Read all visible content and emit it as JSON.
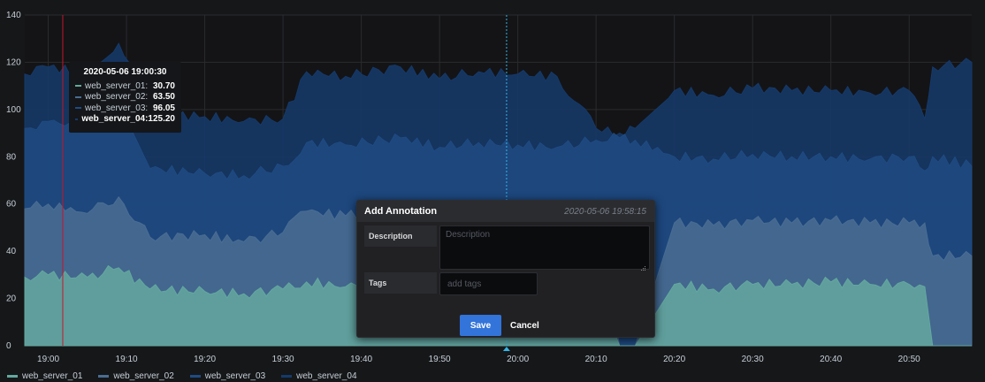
{
  "colors": {
    "background": "#161719",
    "grid": "#2a2b2e",
    "server_01": "#64a89f",
    "server_02": "#4a6d92",
    "server_03": "#1f4b82",
    "server_04": "#153a6b",
    "hover_line": "#c4162a",
    "cursor_line": "#33b5e5",
    "accent": "#3274d9"
  },
  "chart_data": {
    "type": "area",
    "stacked": false,
    "x_unit": "time (HH:MM)",
    "x_ticks": [
      "19:00",
      "19:10",
      "19:20",
      "19:30",
      "19:40",
      "19:50",
      "20:00",
      "20:10",
      "20:20",
      "20:30",
      "20:40",
      "20:50"
    ],
    "y_ticks": [
      "0",
      "20",
      "40",
      "60",
      "80",
      "100",
      "120",
      "140"
    ],
    "ylim": [
      0,
      140
    ],
    "xlim": [
      "18:57",
      "20:58"
    ],
    "grid": true,
    "legend_position": "bottom-left",
    "series": [
      {
        "name": "web_server_01",
        "color": "#64a89f",
        "times": [
          "18:57",
          "19:00",
          "19:05",
          "19:09",
          "19:13",
          "19:20",
          "19:25",
          "19:30",
          "19:33",
          "19:38",
          "19:45",
          "19:50",
          "19:55",
          "20:00",
          "20:05",
          "20:10",
          "20:13",
          "20:15",
          "20:20",
          "20:25",
          "20:30",
          "20:35",
          "20:40",
          "20:45",
          "20:50",
          "20:52",
          "20:53",
          "20:58"
        ],
        "values": [
          29,
          30,
          29,
          33,
          24,
          23,
          22,
          24,
          27,
          25,
          26,
          27,
          26,
          27,
          26,
          26,
          0,
          0,
          26,
          24,
          26,
          26,
          27,
          26,
          26,
          25,
          0,
          0
        ]
      },
      {
        "name": "web_server_02",
        "color": "#4a6d92",
        "times": [
          "18:57",
          "19:00",
          "19:05",
          "19:09",
          "19:13",
          "19:20",
          "19:25",
          "19:30",
          "19:33",
          "19:38",
          "19:45",
          "19:50",
          "19:55",
          "20:00",
          "20:05",
          "20:10",
          "20:13",
          "20:15",
          "20:20",
          "20:25",
          "20:30",
          "20:35",
          "20:40",
          "20:45",
          "20:50",
          "20:52",
          "20:53",
          "20:58"
        ],
        "values": [
          58,
          60,
          56,
          63,
          46,
          47,
          44,
          48,
          57,
          55,
          58,
          55,
          57,
          56,
          55,
          57,
          0,
          0,
          52,
          51,
          53,
          52,
          53,
          52,
          52,
          52,
          38,
          38
        ]
      },
      {
        "name": "web_server_03",
        "color": "#1f4b82",
        "times": [
          "18:57",
          "19:00",
          "19:05",
          "19:09",
          "19:13",
          "19:20",
          "19:25",
          "19:30",
          "19:33",
          "19:38",
          "19:45",
          "19:50",
          "19:55",
          "20:00",
          "20:05",
          "20:10",
          "20:13",
          "20:15",
          "20:20",
          "20:25",
          "20:30",
          "20:35",
          "20:40",
          "20:45",
          "20:50",
          "20:52",
          "20:53",
          "20:58"
        ],
        "values": [
          92,
          95,
          92,
          100,
          75,
          73,
          72,
          76,
          86,
          85,
          88,
          84,
          86,
          85,
          84,
          87,
          88,
          87,
          80,
          79,
          81,
          80,
          80,
          79,
          80,
          74,
          80,
          76
        ]
      },
      {
        "name": "web_server_04",
        "color": "#153a6b",
        "times": [
          "18:57",
          "19:00",
          "19:05",
          "19:09",
          "19:13",
          "19:20",
          "19:25",
          "19:30",
          "19:33",
          "19:38",
          "19:45",
          "19:50",
          "19:55",
          "20:00",
          "20:05",
          "20:10",
          "20:13",
          "20:15",
          "20:20",
          "20:25",
          "20:30",
          "20:35",
          "20:40",
          "20:45",
          "20:50",
          "20:52",
          "20:53",
          "20:58"
        ],
        "values": [
          115,
          118,
          115,
          128,
          98,
          97,
          95,
          96,
          116,
          114,
          118,
          113,
          116,
          115,
          114,
          92,
          90,
          92,
          108,
          106,
          109,
          108,
          108,
          107,
          108,
          96,
          118,
          120
        ]
      }
    ]
  },
  "tooltip": {
    "time": "2020-05-06 19:00:30",
    "rows": [
      {
        "name": "web_server_01:",
        "value": "30.70",
        "color": "#64a89f"
      },
      {
        "name": "web_server_02:",
        "value": "63.50",
        "color": "#4a6d92"
      },
      {
        "name": "web_server_03:",
        "value": "96.05",
        "color": "#1f4b82"
      },
      {
        "name": "web_server_04:",
        "value": "125.20",
        "color": "#153a6b"
      }
    ]
  },
  "annotation": {
    "title": "Add Annotation",
    "time": "2020-05-06 19:58:15",
    "description_label": "Description",
    "description_placeholder": "Description",
    "description_value": "",
    "tags_label": "Tags",
    "tags_placeholder": "add tags",
    "save_label": "Save",
    "cancel_label": "Cancel"
  },
  "legend": [
    {
      "name": "web_server_01",
      "color": "#64a89f"
    },
    {
      "name": "web_server_02",
      "color": "#4a6d92"
    },
    {
      "name": "web_server_03",
      "color": "#1f4b82"
    },
    {
      "name": "web_server_04",
      "color": "#153a6b"
    }
  ]
}
